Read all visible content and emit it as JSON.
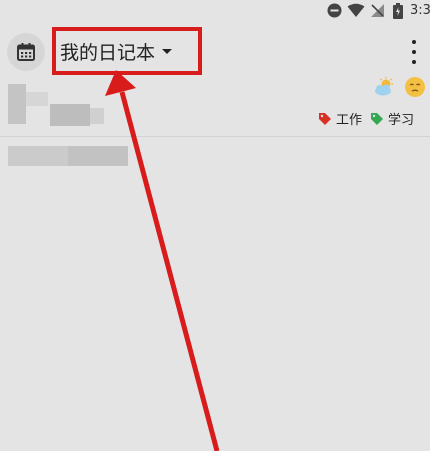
{
  "status_bar": {
    "time": "3:3",
    "icons": [
      "do-not-disturb-icon",
      "wifi-icon",
      "no-signal-icon",
      "battery-icon"
    ]
  },
  "app_bar": {
    "title": "我的日记本",
    "title_icon": "chevron-down-icon",
    "left_icon": "calendar-icon",
    "right_icon": "more-vert-icon"
  },
  "entry": {
    "weather_icon": "partly-cloudy-icon",
    "mood_icon": "mood-face-icon",
    "tags": [
      {
        "label": "工作",
        "color": "#d93025"
      },
      {
        "label": "学习",
        "color": "#34a853"
      }
    ]
  },
  "annotation": {
    "color": "#d81b1b"
  }
}
